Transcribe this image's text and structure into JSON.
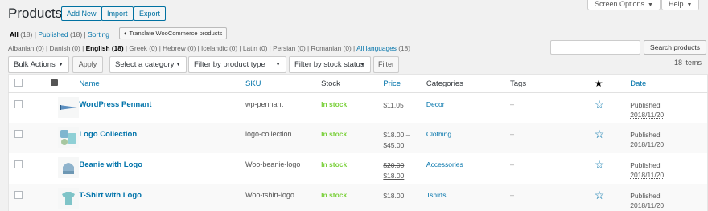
{
  "header": {
    "title": "Products",
    "add_new": "Add New",
    "import": "Import",
    "export": "Export",
    "screen_options": "Screen Options",
    "help": "Help"
  },
  "views": {
    "all": "All",
    "all_count": "(18)",
    "published": "Published",
    "published_count": "(18)",
    "sorting": "Sorting",
    "translate": "Translate WooCommerce products"
  },
  "languages": {
    "before": "Albanian (0) | Danish (0) |",
    "english": "English (18)",
    "after": "| Greek (0) | Hebrew (0) | Icelandic (0) | Latin (0) | Persian (0) | Romanian (0) |",
    "all_link": "All languages",
    "all_count": "(18)"
  },
  "search": {
    "input_value": "",
    "button": "Search products"
  },
  "filters": {
    "bulk_actions": "Bulk Actions",
    "apply": "Apply",
    "category": "Select a category",
    "product_type": "Filter by product type",
    "stock_status": "Filter by stock status",
    "filter": "Filter",
    "items_count": "18 items"
  },
  "table": {
    "columns": {
      "name": "Name",
      "sku": "SKU",
      "stock": "Stock",
      "price": "Price",
      "categories": "Categories",
      "tags": "Tags",
      "date": "Date"
    },
    "rows": [
      {
        "name": "WordPress Pennant",
        "sku": "wp-pennant",
        "stock": "In stock",
        "price": "$11.05",
        "price2": "",
        "price_old": "",
        "price_new": "",
        "category": "Decor",
        "tags": "–",
        "date_status": "Published",
        "date_value": "2018/11/20",
        "thumb": "pennant"
      },
      {
        "name": "Logo Collection",
        "sku": "logo-collection",
        "stock": "In stock",
        "price": "$18.00 –",
        "price2": "$45.00",
        "price_old": "",
        "price_new": "",
        "category": "Clothing",
        "tags": "–",
        "date_status": "Published",
        "date_value": "2018/11/20",
        "thumb": "collection"
      },
      {
        "name": "Beanie with Logo",
        "sku": "Woo-beanie-logo",
        "stock": "In stock",
        "price": "",
        "price2": "",
        "price_old": "$20.00",
        "price_new": "$18.00",
        "category": "Accessories",
        "tags": "–",
        "date_status": "Published",
        "date_value": "2018/11/20",
        "thumb": "beanie"
      },
      {
        "name": "T-Shirt with Logo",
        "sku": "Woo-tshirt-logo",
        "stock": "In stock",
        "price": "$18.00",
        "price2": "",
        "price_old": "",
        "price_new": "",
        "category": "Tshirts",
        "tags": "–",
        "date_status": "Published",
        "date_value": "2018/11/20",
        "thumb": "tshirt"
      }
    ]
  },
  "colors": {
    "link": "#0073aa",
    "in_stock": "#7ad03a",
    "button_border": "#0071a1"
  }
}
